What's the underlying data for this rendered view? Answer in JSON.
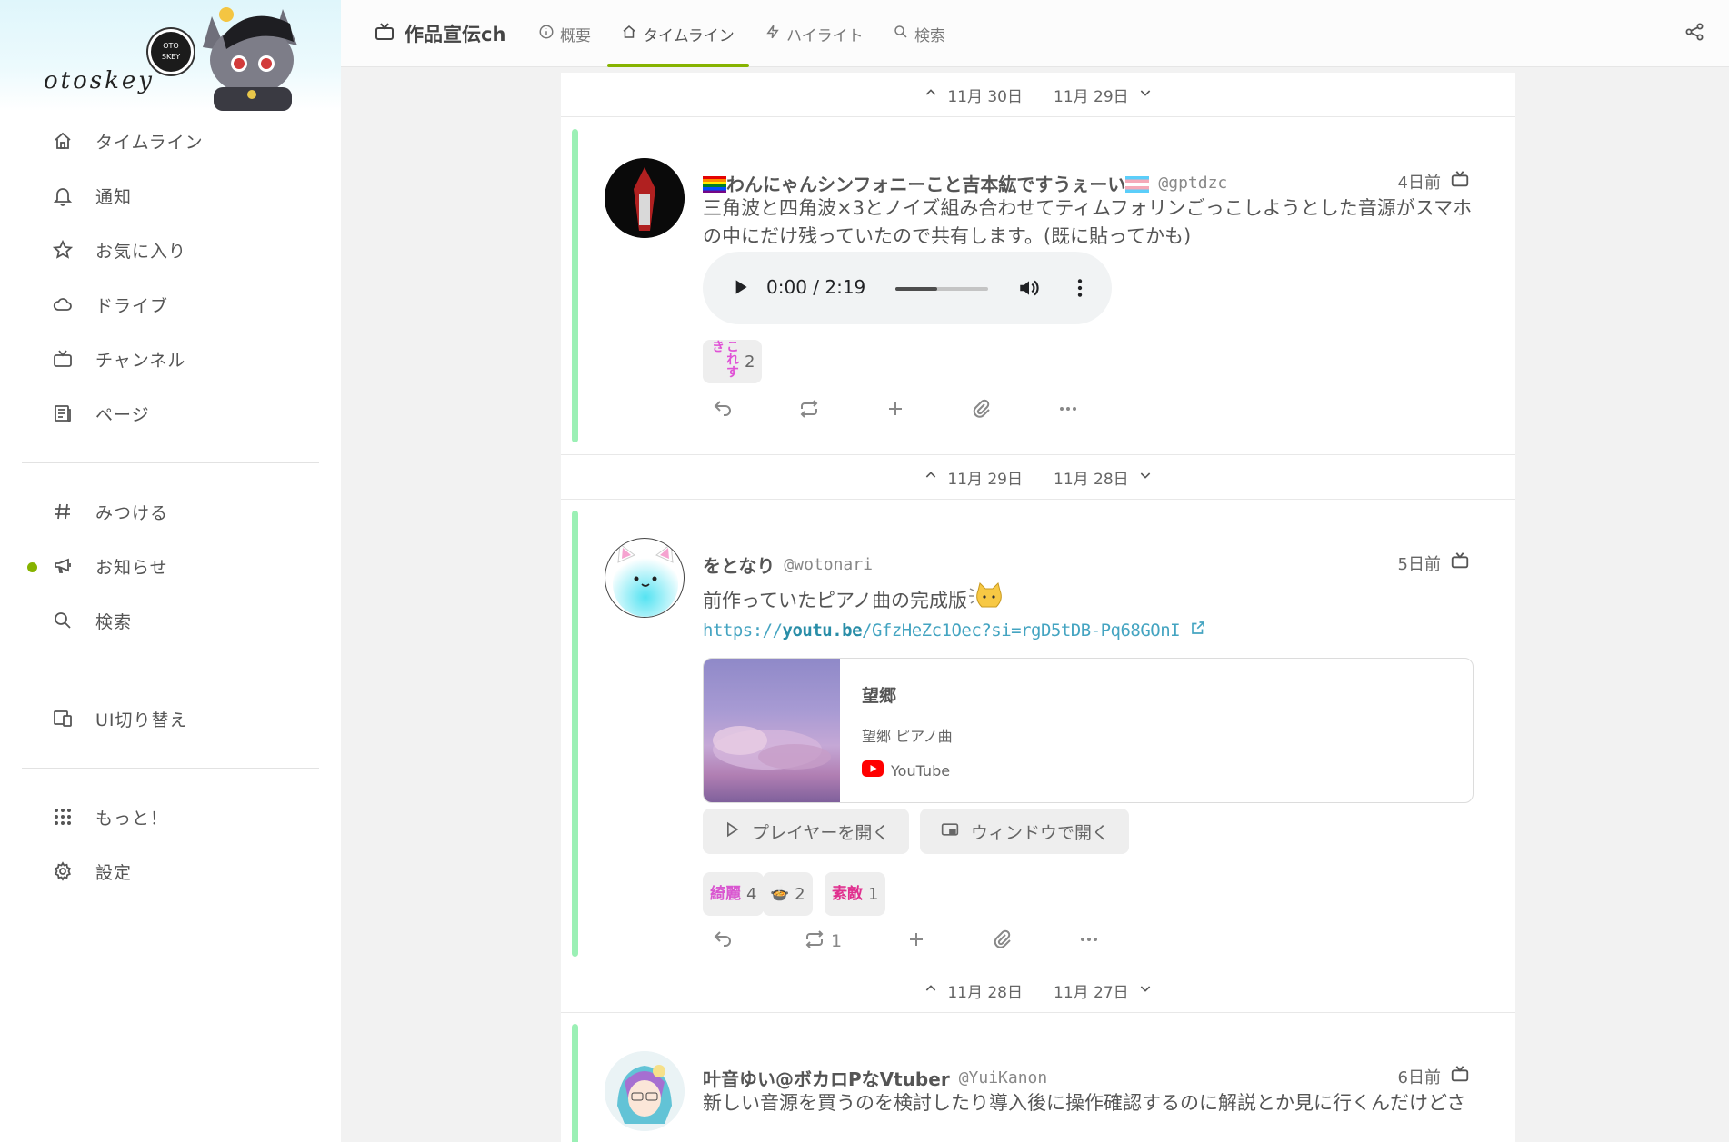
{
  "sidebar": {
    "instance_name": "otoskey",
    "logo_top": "OTO",
    "logo_bottom": "SKEY",
    "items": [
      {
        "label": "タイムライン",
        "icon": "home-icon"
      },
      {
        "label": "通知",
        "icon": "bell-icon"
      },
      {
        "label": "お気に入り",
        "icon": "star-icon"
      },
      {
        "label": "ドライブ",
        "icon": "cloud-icon"
      },
      {
        "label": "チャンネル",
        "icon": "tv-icon"
      },
      {
        "label": "ページ",
        "icon": "page-icon"
      },
      {
        "label": "みつける",
        "icon": "hashtag-icon"
      },
      {
        "label": "お知らせ",
        "icon": "speakerphone-icon"
      },
      {
        "label": "検索",
        "icon": "search-icon"
      },
      {
        "label": "UI切り替え",
        "icon": "devices-icon"
      },
      {
        "label": "もっと！",
        "icon": "grid-dots-icon"
      },
      {
        "label": "設定",
        "icon": "gear-icon"
      }
    ]
  },
  "header": {
    "channel_title": "作品宣伝ch",
    "tabs": [
      {
        "label": "概要",
        "icon": "info-icon"
      },
      {
        "label": "タイムライン",
        "icon": "home-icon"
      },
      {
        "label": "ハイライト",
        "icon": "bolt-icon"
      },
      {
        "label": "検索",
        "icon": "search-icon"
      }
    ],
    "active_tab": "タイムライン"
  },
  "colors": {
    "accent": "#86b300",
    "note_bar": "#9bf0b5",
    "link": "#44a4c1"
  },
  "date_separators": [
    {
      "prev": "11月 30日",
      "next": "11月 29日"
    },
    {
      "prev": "11月 29日",
      "next": "11月 28日"
    },
    {
      "prev": "11月 28日",
      "next": "11月 27日"
    }
  ],
  "notes": [
    {
      "display_name": "わんにゃんシンフォニーこと吉本紘ですうぇーい",
      "username": "@gptdzc",
      "time": "4日前",
      "text": "三角波と四角波×3とノイズ組み合わせてティムフォリンごっこしようとした音源がスマホの中にだけ残っていたので共有します。(既に貼ってかも)",
      "audio": {
        "time": "0:00 / 2:19",
        "progress": 0.45
      },
      "reactions": [
        {
          "emoji": "これすき",
          "count": "2"
        }
      ]
    },
    {
      "display_name": "をとなり",
      "username": "@wotonari",
      "time": "5日前",
      "text": "前作っていたピアノ曲の完成版",
      "link": {
        "scheme": "https://",
        "host": "youtu.be",
        "path": "/GfzHeZc1Oec",
        "query": "?si=rgD5tDB-Pq68GOnI"
      },
      "card": {
        "title": "望郷",
        "description": "望郷 ピアノ曲",
        "site": "YouTube"
      },
      "buttons": {
        "player": "プレイヤーを開く",
        "window": "ウィンドウで開く"
      },
      "reactions": [
        {
          "emoji": "綺麗",
          "count": "4"
        },
        {
          "emoji": "🍲",
          "count": "2"
        },
        {
          "emoji": "素敵",
          "count": "1"
        }
      ],
      "renote_count": "1"
    },
    {
      "display_name": "叶音ゆい@ボカロPなVtuber",
      "username": "@YuiKanon",
      "time": "6日前",
      "text": "新しい音源を買うのを検討したり導入後に操作確認するのに解説とか見に行くんだけどさ"
    }
  ]
}
